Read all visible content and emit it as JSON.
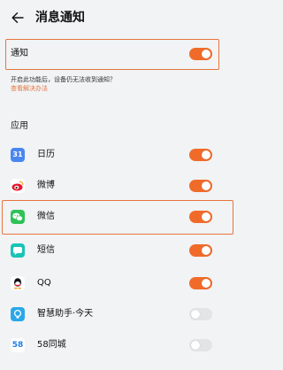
{
  "header": {
    "title": "消息通知",
    "back_icon": "arrow-left-icon"
  },
  "notification": {
    "label": "通知",
    "enabled": true
  },
  "hint": {
    "text": "开启此功能后，设备仍无法收到通知？",
    "link": "查看解决办法"
  },
  "apps": {
    "section_title": "应用",
    "items": [
      {
        "name": "日历",
        "icon": "calendar-icon",
        "icon_label": "31",
        "color": "#4a86f0",
        "enabled": true
      },
      {
        "name": "微博",
        "icon": "weibo-icon",
        "icon_label": "",
        "color": "#ffffff",
        "enabled": true
      },
      {
        "name": "微信",
        "icon": "wechat-icon",
        "icon_label": "",
        "color": "#2ec257",
        "enabled": true
      },
      {
        "name": "短信",
        "icon": "sms-icon",
        "icon_label": "",
        "color": "#18c3b6",
        "enabled": true
      },
      {
        "name": "QQ",
        "icon": "qq-icon",
        "icon_label": "",
        "color": "#ffffff",
        "enabled": true
      },
      {
        "name": "智慧助手·今天",
        "icon": "assistant-icon",
        "icon_label": "",
        "color": "#2aa7e8",
        "enabled": false
      },
      {
        "name": "58同城",
        "icon": "58-icon",
        "icon_label": "58",
        "color": "#ffffff",
        "enabled": false
      }
    ]
  },
  "colors": {
    "accent": "#f06b2a",
    "highlight": "#e8743d",
    "toggle_off": "#e3e4e6",
    "background": "#f1f3f5"
  }
}
